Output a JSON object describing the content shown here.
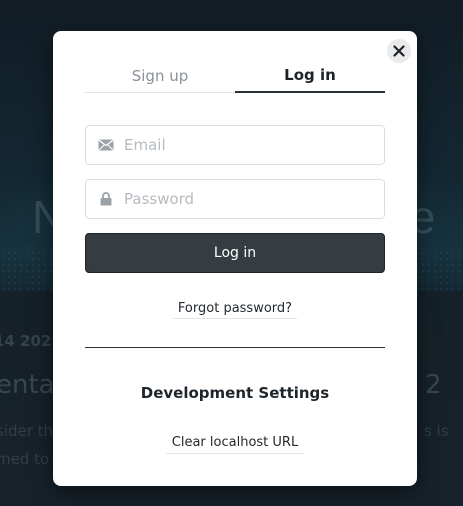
{
  "background": {
    "headline_left": "N",
    "headline_right": "e",
    "date_fragment": "14 202",
    "title_fragment": "ental",
    "title_right_fragment": "2",
    "body_line1": "sider th",
    "body_line1_right": "s is",
    "body_line2": "med to"
  },
  "modal": {
    "close_icon": "close-icon",
    "tabs": [
      {
        "label": "Sign up",
        "active": false
      },
      {
        "label": "Log in",
        "active": true
      }
    ],
    "email": {
      "placeholder": "Email",
      "value": "",
      "icon": "envelope-icon"
    },
    "password": {
      "placeholder": "Password",
      "value": "",
      "icon": "lock-icon"
    },
    "login_button": "Log in",
    "forgot_link": "Forgot password?",
    "dev_heading": "Development Settings",
    "clear_url_link": "Clear localhost URL"
  },
  "colors": {
    "button_bg": "#353d42",
    "active_tab_text": "#1c2328",
    "inactive_tab_text": "#8a9197"
  }
}
